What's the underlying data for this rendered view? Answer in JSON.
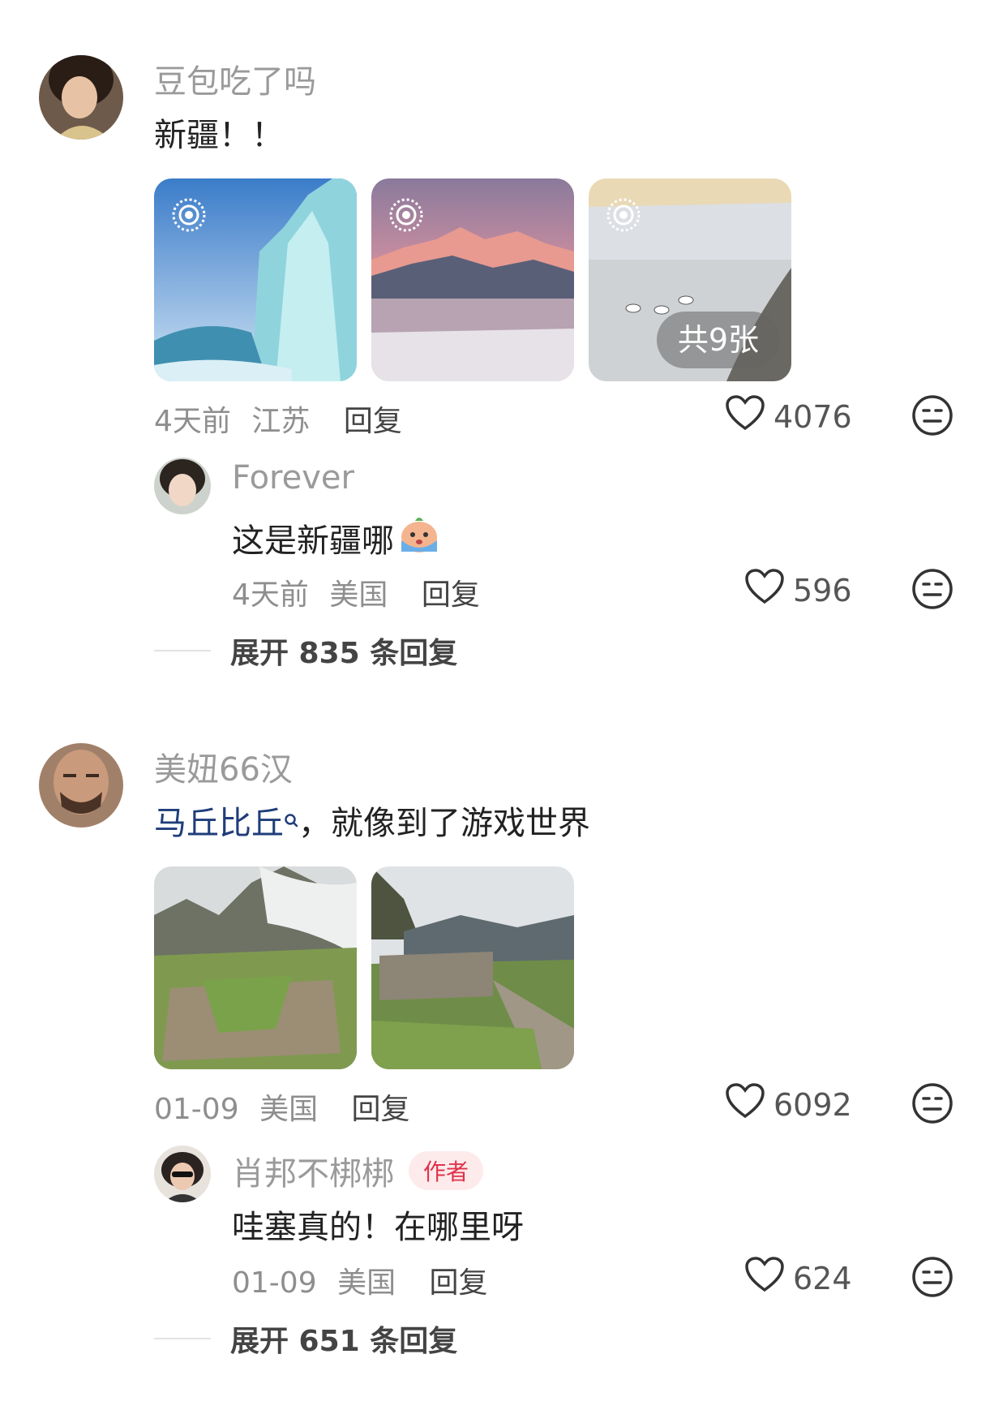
{
  "comments": [
    {
      "username": "豆包吃了吗",
      "text": "新疆！！",
      "photo_count": "共9张",
      "time": "4天前",
      "location": "江苏",
      "reply_label": "回复",
      "likes": "4076",
      "replies": [
        {
          "username": "Forever",
          "text": "这是新疆哪",
          "time": "4天前",
          "location": "美国",
          "reply_label": "回复",
          "likes": "596"
        }
      ],
      "expand_label": "展开 835 条回复"
    },
    {
      "username": "美妞66汉",
      "text_link": "马丘比丘",
      "text_rest": "，就像到了游戏世界",
      "time": "01-09",
      "location": "美国",
      "reply_label": "回复",
      "likes": "6092",
      "replies": [
        {
          "username": "肖邦不梆梆",
          "badge": "作者",
          "text": "哇塞真的！在哪里呀",
          "time": "01-09",
          "location": "美国",
          "reply_label": "回复",
          "likes": "624"
        }
      ],
      "expand_label": "展开 651 条回复"
    }
  ],
  "icons": {
    "like": "heart-outline-icon",
    "dislike": "neutral-face-icon",
    "live_photo": "live-photo-icon",
    "search_link": "search-small-icon"
  },
  "colors": {
    "link": "#1f3d7a",
    "author_badge_text": "#e1324a",
    "author_badge_bg": "#fdebec"
  }
}
